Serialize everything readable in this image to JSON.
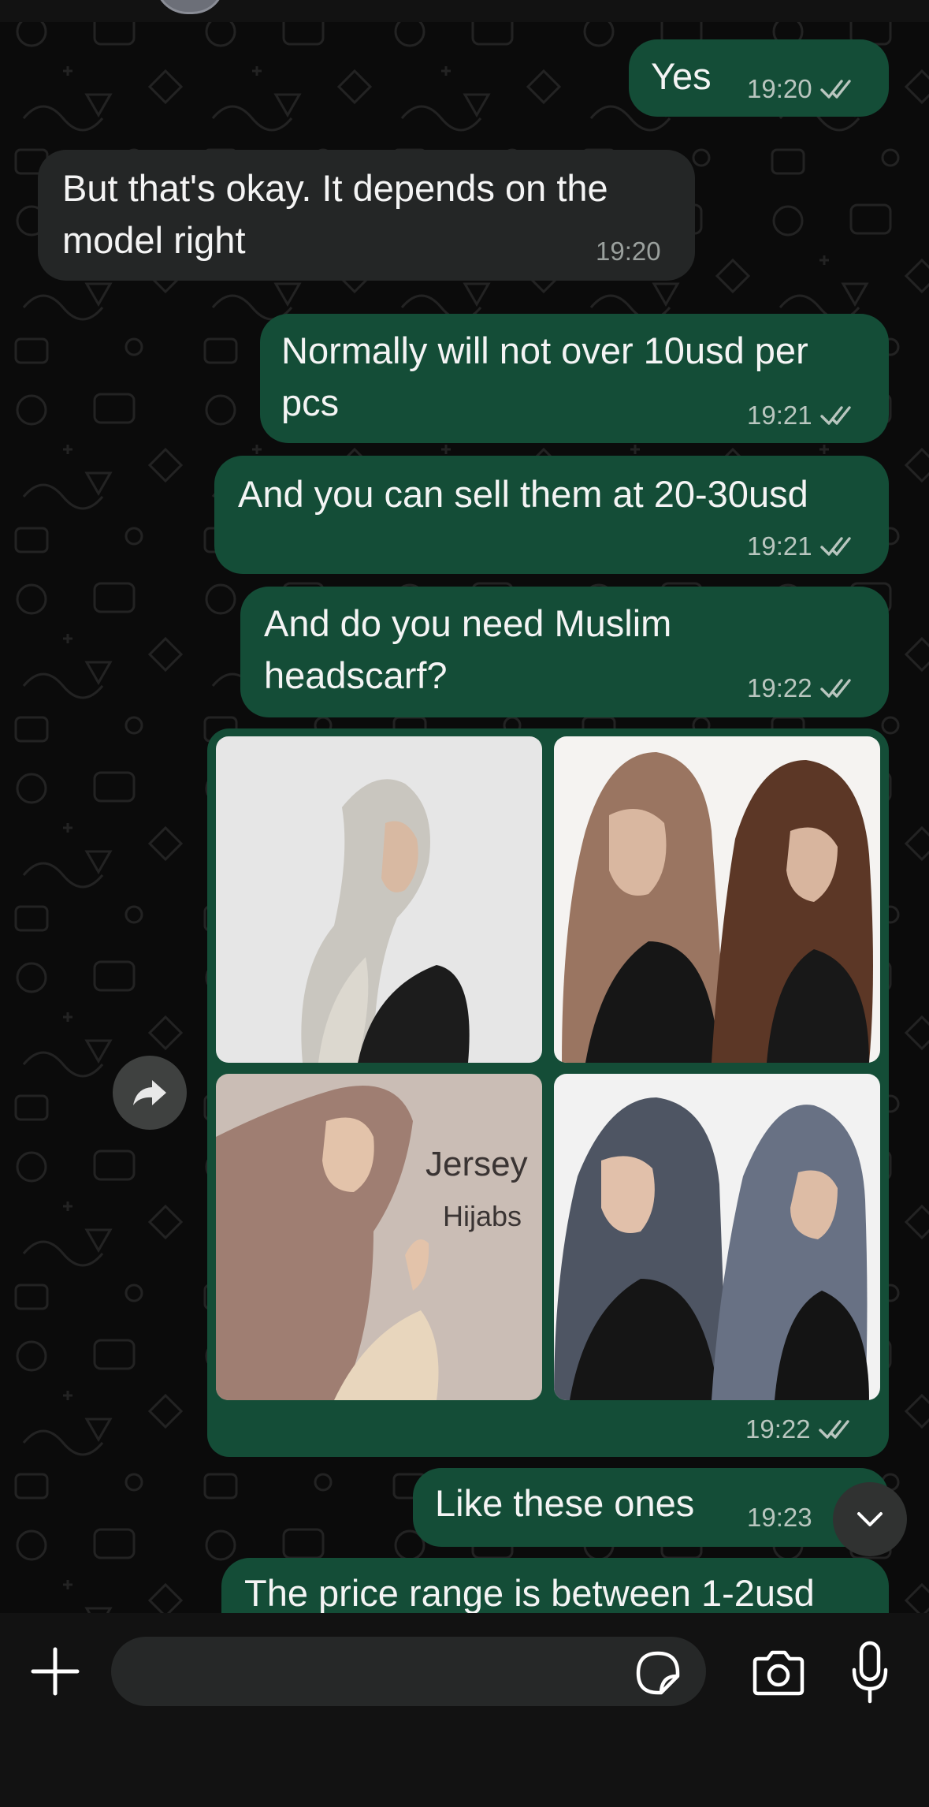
{
  "chat": {
    "messages": [
      {
        "direction": "outgoing",
        "text": "Yes",
        "time": "19:20",
        "status": "read"
      },
      {
        "direction": "incoming",
        "lines": [
          "But that's okay. It depends on the",
          "model right"
        ],
        "time": "19:20"
      },
      {
        "direction": "outgoing",
        "lines": [
          "Normally will not over 10usd per",
          "pcs"
        ],
        "time": "19:21",
        "status": "read"
      },
      {
        "direction": "outgoing",
        "text": "And you can sell them at 20-30usd",
        "time": "19:21",
        "status": "read"
      },
      {
        "direction": "outgoing",
        "lines": [
          "And do you need Muslim",
          "headscarf?"
        ],
        "time": "19:22",
        "status": "read"
      },
      {
        "direction": "outgoing",
        "type": "image-album",
        "photo_text": {
          "title": "Jersey",
          "subtitle": "Hijabs"
        },
        "time": "19:22",
        "status": "read"
      },
      {
        "direction": "outgoing",
        "text": "Like these ones",
        "time": "19:23"
      },
      {
        "direction": "outgoing",
        "text": "The price range is between 1-2usd"
      }
    ]
  },
  "icons": {
    "read_receipt": "double-check-icon",
    "forward": "forward-arrow-icon",
    "scroll_down": "chevron-down-icon",
    "attach": "plus-icon",
    "sticker": "sticker-icon",
    "camera": "camera-icon",
    "voice": "microphone-icon"
  },
  "colors": {
    "background": "#0b0b0b",
    "outgoing_bubble": "#144d37",
    "incoming_bubble": "#242626",
    "composer_bar": "#121212"
  }
}
